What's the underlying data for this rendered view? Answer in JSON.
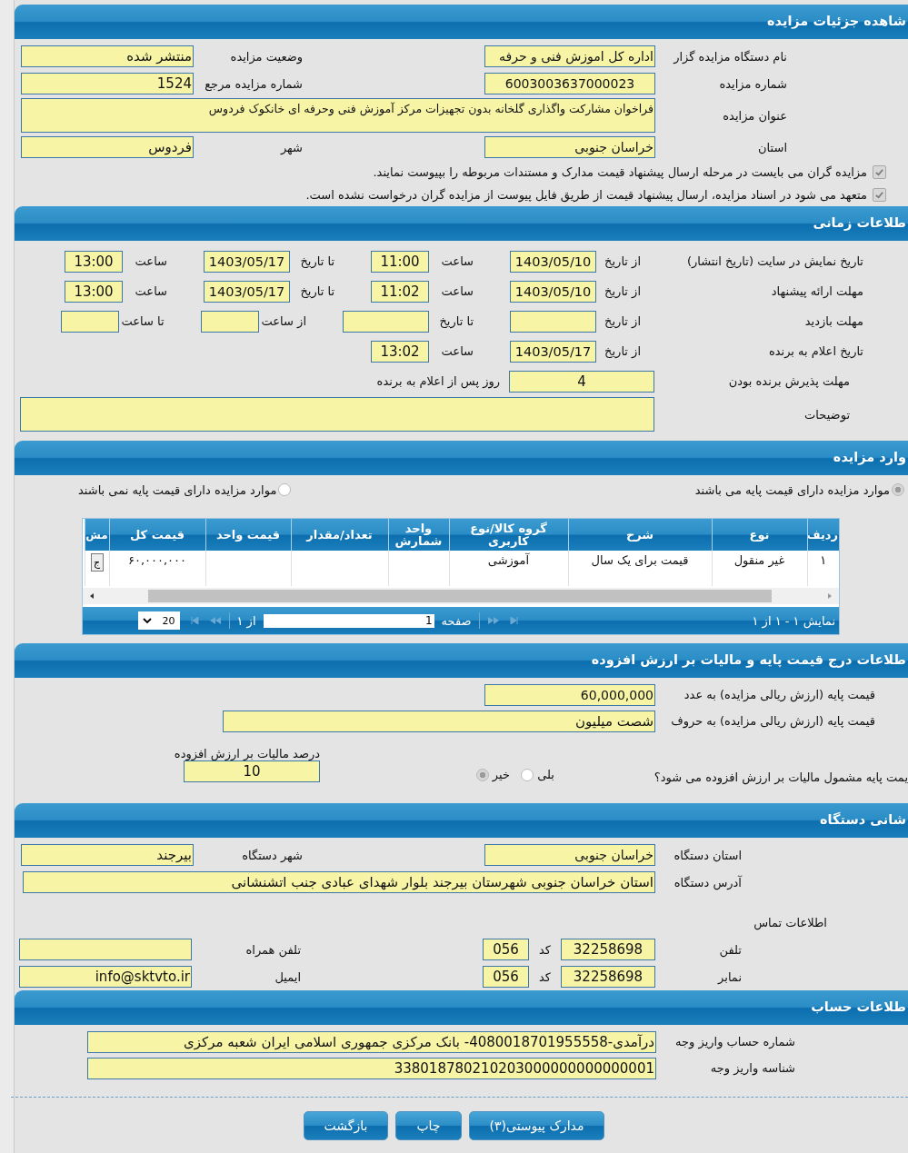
{
  "details": {
    "title": "شاهده جزئیات مزایده",
    "organizer": {
      "label": "نام دستگاه مزایده گزار",
      "value": "اداره کل اموزش فنی و حرفه"
    },
    "status": {
      "label": "وضعیت مزایده",
      "value": "منتشر شده"
    },
    "auction_number": {
      "label": "شماره مزایده",
      "value": "6003003637000023"
    },
    "reference_number": {
      "label": "شماره مزایده مرجع",
      "value": "1524"
    },
    "auction_title": {
      "label": "عنوان مزایده",
      "value": "فراخوان مشارکت  واگذاری گلخانه بدون تجهیزات  مرکز آموزش فنی وحرفه ای خانکوک فردوس"
    },
    "province": {
      "label": "استان",
      "value": "خراسان جنوبی"
    },
    "city": {
      "label": "شهر",
      "value": "فردوس"
    },
    "checks": [
      {
        "label": "مزایده گران می بایست در مرحله ارسال پیشنهاد قیمت مدارک و مستندات مربوطه را بپیوست نمایند.",
        "checked": true
      },
      {
        "label": "متعهد می شود در اسناد مزایده، ارسال پیشنهاد قیمت از طریق فایل پیوست از مزایده گران درخواست نشده است.",
        "checked": true
      }
    ]
  },
  "timing": {
    "title": "طلاعات زمانی",
    "rows": [
      {
        "label": "تاریخ نمایش در سایت (تاریخ انتشار)",
        "parts": [
          {
            "kind": "date",
            "label": "از تاریخ",
            "value": "1403/05/10"
          },
          {
            "kind": "time",
            "label": "ساعت",
            "value": "11:00"
          },
          {
            "kind": "date",
            "label": "تا تاریخ",
            "value": "1403/05/17"
          },
          {
            "kind": "time",
            "label": "ساعت",
            "value": "13:00"
          }
        ]
      },
      {
        "label": "مهلت ارائه پیشنهاد",
        "parts": [
          {
            "kind": "date",
            "label": "از تاریخ",
            "value": "1403/05/10"
          },
          {
            "kind": "time",
            "label": "ساعت",
            "value": "11:02"
          },
          {
            "kind": "date",
            "label": "تا تاریخ",
            "value": "1403/05/17"
          },
          {
            "kind": "time",
            "label": "ساعت",
            "value": "13:00"
          }
        ]
      },
      {
        "label": "مهلت بازدید",
        "parts": [
          {
            "kind": "date",
            "label": "از تاریخ"
          },
          {
            "kind": "date",
            "label": "تا تاریخ"
          },
          {
            "kind": "time",
            "label": "از ساعت"
          },
          {
            "kind": "time",
            "label": "تا ساعت"
          }
        ]
      },
      {
        "label": "تاریخ اعلام به برنده",
        "parts": [
          {
            "kind": "date",
            "label": "از تاریخ",
            "value": "1403/05/17"
          },
          {
            "kind": "time",
            "label": "ساعت",
            "value": "13:02"
          }
        ]
      }
    ],
    "acceptance": {
      "label": "مهلت پذیرش برنده بودن",
      "value": "4",
      "suffix": "روز پس از اعلام به برنده"
    },
    "notes": {
      "label": "توضیحات"
    }
  },
  "items": {
    "title": "وارد مزایده",
    "options": [
      {
        "label": "موارد مزایده دارای قیمت پایه می باشند",
        "selected": true
      },
      {
        "label": "موارد مزایده دارای قیمت پایه نمی باشند",
        "selected": false
      }
    ],
    "table": {
      "columns": [
        "ردیف",
        "نوع",
        "شرح",
        "گروه کالا/نوع کاربری",
        "واحد شمارش",
        "تعداد/مقدار",
        "قیمت واحد",
        "قیمت کل",
        "مش"
      ],
      "rows": [
        {
          "cells": [
            "۱",
            "غیر منقول",
            "قیمت برای یک سال",
            "آموزشی",
            null,
            null,
            null,
            "۶۰,۰۰۰,۰۰۰"
          ],
          "action": "ج"
        }
      ]
    },
    "pager": {
      "summary": "نمایش ۱ - ۱ از ۱",
      "page_label": "صفحه",
      "page": "1",
      "of": "از ۱",
      "page_size": "20"
    }
  },
  "pricing": {
    "title": "طلاعات درج قیمت پایه و مالیات بر ارزش افزوده",
    "amount": {
      "label": "قیمت پایه (ارزش ریالی مزایده) به عدد",
      "value": "60,000,000"
    },
    "amount_words": {
      "label": "قیمت پایه (ارزش ریالی مزایده) به حروف",
      "value": "شصت میلیون"
    },
    "vat_question": "یمت پایه مشمول مالیات بر ارزش افزوده می شود؟",
    "vat_options": [
      {
        "label": "بلی",
        "selected": false
      },
      {
        "label": "خیر",
        "selected": true
      }
    ],
    "vat_rate": {
      "label": "درصد مالیات بر ارزش افزوده",
      "value": "10"
    }
  },
  "address": {
    "title": "شانی دستگاه",
    "province": {
      "label": "استان دستگاه",
      "value": "خراسان جنوبی"
    },
    "city": {
      "label": "شهر دستگاه",
      "value": "بیرجند"
    },
    "address": {
      "label": "آدرس دستگاه",
      "value": "استان خراسان جنوبی شهرستان بیرجند بلوار شهدای عبادی جنب اتشنشانی"
    },
    "contact_title": "اطلاعات تماس",
    "phone": {
      "label": "تلفن",
      "value": "32258698",
      "code_label": "کد",
      "code": "056"
    },
    "mobile": {
      "label": "تلفن همراه"
    },
    "fax": {
      "label": "نمابر",
      "value": "32258698",
      "code_label": "کد",
      "code": "056"
    },
    "email": {
      "label": "ایمیل",
      "value": "info@sktvto.ir"
    }
  },
  "account": {
    "title": "طلاعات حساب",
    "fields": [
      {
        "label": "شماره حساب واریز وجه",
        "value": "درآمدی-4080018701955558- بانک مرکزی جمهوری اسلامی ایران شعبه مرکزی"
      },
      {
        "label": "شناسه واریز وجه",
        "value": "338018780210203000000000000001"
      }
    ]
  },
  "buttons": [
    "مدارک پیوستی(۳)",
    "چاپ",
    "بازگشت"
  ]
}
